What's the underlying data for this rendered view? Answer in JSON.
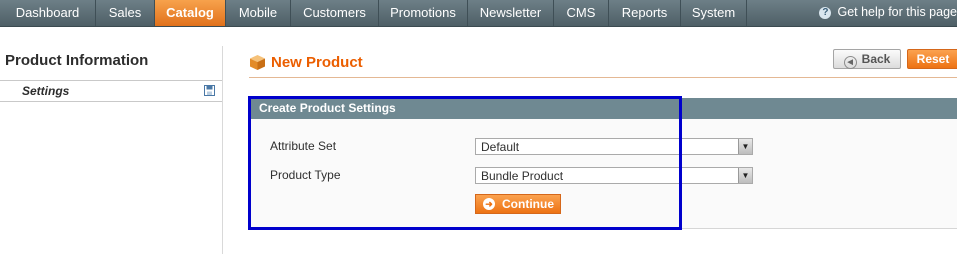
{
  "nav": {
    "items": [
      {
        "label": "Dashboard"
      },
      {
        "label": "Sales"
      },
      {
        "label": "Catalog"
      },
      {
        "label": "Mobile"
      },
      {
        "label": "Customers"
      },
      {
        "label": "Promotions"
      },
      {
        "label": "Newsletter"
      },
      {
        "label": "CMS"
      },
      {
        "label": "Reports"
      },
      {
        "label": "System"
      }
    ],
    "active": "Catalog",
    "help_label": "Get help for this page"
  },
  "sidebar": {
    "title": "Product Information",
    "items": [
      {
        "label": "Settings",
        "icon": "save-icon"
      }
    ]
  },
  "header": {
    "title": "New Product",
    "back_label": "Back",
    "reset_label": "Reset"
  },
  "panel": {
    "title": "Create Product Settings",
    "attribute_set_label": "Attribute Set",
    "attribute_set_value": "Default",
    "product_type_label": "Product Type",
    "product_type_value": "Bundle Product",
    "continue_label": "Continue"
  },
  "colors": {
    "accent": "#eb5e00",
    "highlight": "#0000cc",
    "nav_bg": "#5b6c73",
    "panel_head": "#6f8992"
  }
}
